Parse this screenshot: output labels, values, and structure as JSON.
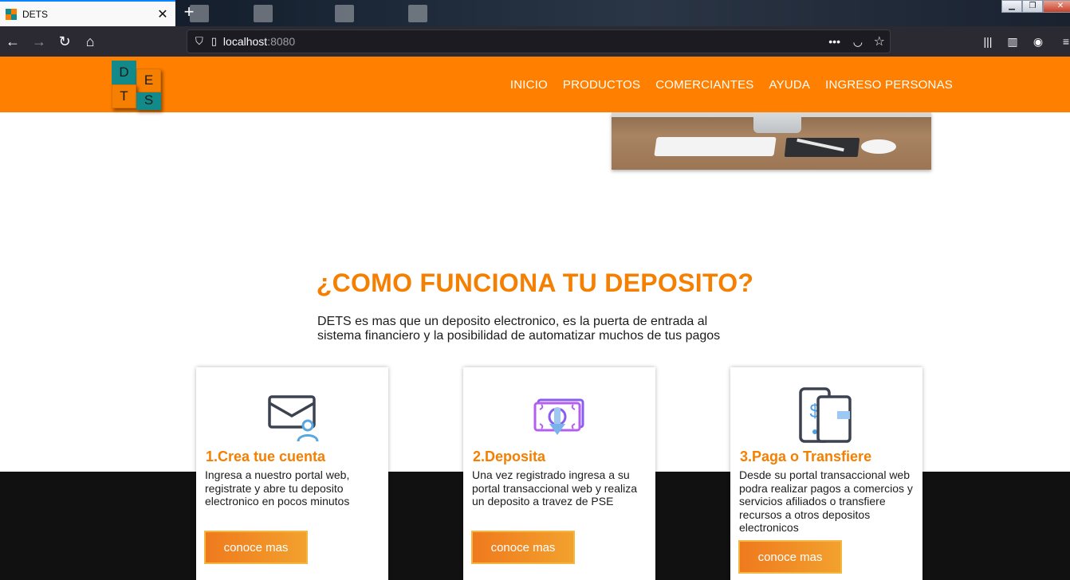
{
  "browser": {
    "tab_title": "DETS",
    "url_host": "localhost",
    "url_port": ":8080",
    "icons": [
      "back-icon",
      "forward-icon",
      "reload-icon",
      "home-icon",
      "shield-icon",
      "page-icon",
      "more-icon",
      "pocket-icon",
      "bookmark-star-icon",
      "library-icon",
      "sidebar-icon",
      "account-icon",
      "menu-icon"
    ]
  },
  "site": {
    "logo_letters": [
      "D",
      "E",
      "T",
      "S"
    ],
    "nav": [
      "INICIO",
      "PRODUCTOS",
      "COMERCIANTES",
      "AYUDA",
      "INGRESO PERSONAS"
    ],
    "colors": {
      "primary": "#ff7f00",
      "accent": "#138a8a",
      "dark": "#111111"
    }
  },
  "section": {
    "title": "¿COMO FUNCIONA TU DEPOSITO?",
    "desc_line1": "DETS es mas que un deposito electronico, es la puerta de entrada al",
    "desc_line2": "sistema financiero y la posibilidad de automatizar muchos de tus pagos"
  },
  "cards": [
    {
      "title": "1.Crea tue cuenta",
      "text": "Ingresa a nuestro portal web, registrate y abre tu deposito electronico en pocos minutos",
      "button": "conoce mas",
      "icon": "envelope-user-icon"
    },
    {
      "title": "2.Deposita",
      "text": "Una vez registrado ingresa a su portal transaccional web y realiza un deposito a travez de PSE",
      "button": "conoce mas",
      "icon": "money-deposit-icon"
    },
    {
      "title": "3.Paga o Transfiere",
      "text": "Desde su portal transaccional web podra realizar pagos a comercios y servicios afiliados o transfiere recursos a otros depositos electronicos",
      "button": "conoce mas",
      "icon": "phone-card-payment-icon"
    }
  ]
}
